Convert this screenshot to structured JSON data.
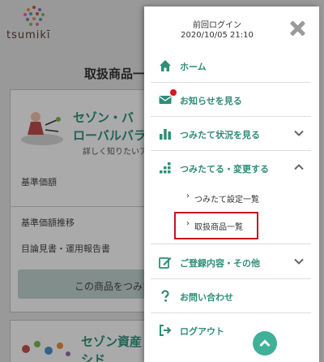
{
  "background": {
    "logo_text": "tsumikī",
    "page_title": "取扱商品一",
    "fund1_title_line1": "セゾン・バ",
    "fund1_title_line2": "ローバルバラ",
    "fund1_subtitle": "詳しく知りたいア",
    "row_base_price": "基準価額",
    "row_price_history": "基準価額推移",
    "row_documents": "目論見書・運用報告書",
    "button_label": "この商品をつみた",
    "fund2_title_line1": "セゾン資産",
    "fund2_title_line2": "シド"
  },
  "drawer": {
    "last_login_label": "前回ログイン",
    "last_login_time": "2020/10/05 21:10",
    "menu": {
      "home": "ホーム",
      "news": "お知らせを見る",
      "status": "つみたて状況を見る",
      "change": "つみたてる・変更する",
      "sub_settings": "つみたて設定一覧",
      "sub_products": "取扱商品一覧",
      "registration": "ご登録内容・その他",
      "inquiry": "お問い合わせ",
      "logout": "ログアウト"
    },
    "icons": {
      "close": "close-icon",
      "home": "home-icon",
      "news": "mail-icon",
      "status": "bar-chart-icon",
      "change": "stairs-chart-icon",
      "registration": "edit-icon",
      "inquiry": "question-icon",
      "logout": "logout-icon",
      "scroll_top": "chevron-up-icon"
    },
    "colors": {
      "accent": "#2f8d78",
      "highlight": "#c8141e",
      "badge": "#d7141e",
      "scroll_top": "#3fb198"
    }
  }
}
